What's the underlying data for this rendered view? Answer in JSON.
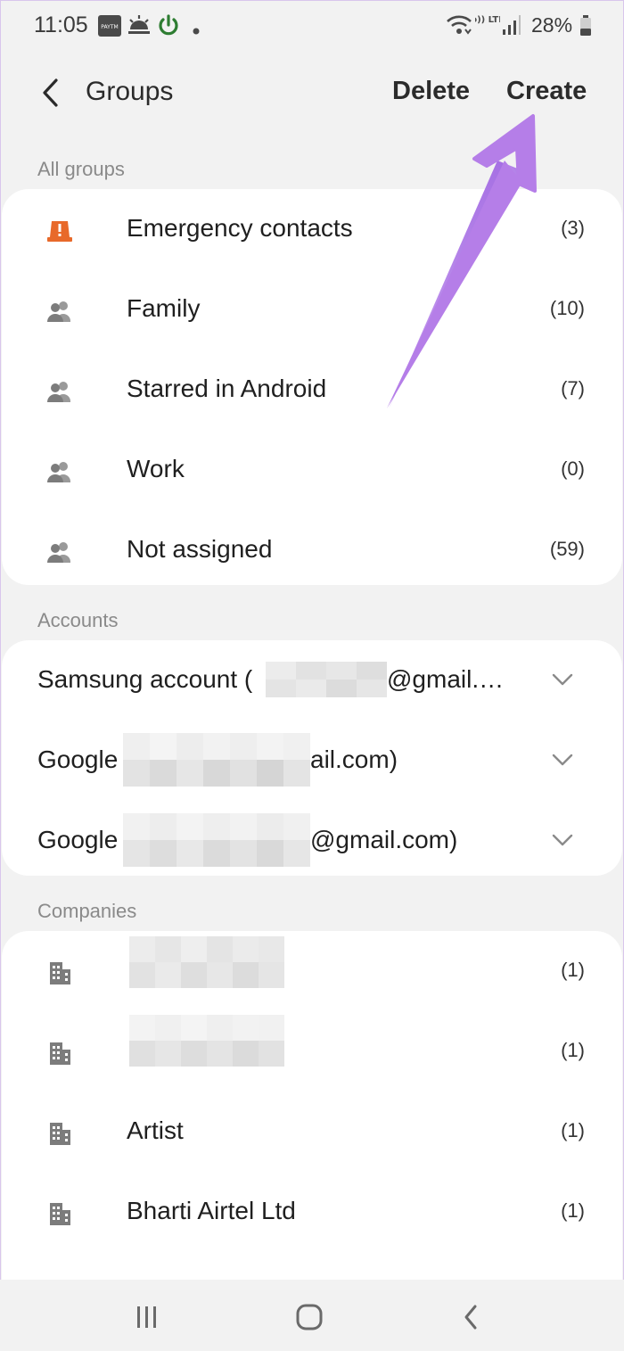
{
  "status_bar": {
    "time": "11:05",
    "paytm_label": "PAYTM",
    "volte_label": "Vo)) LTE1",
    "battery_percent": "28%",
    "icons": [
      "paytm-icon",
      "weather-icon",
      "power-icon",
      "dot-icon",
      "wifi-icon",
      "volte-icon",
      "signal-icon",
      "battery-icon"
    ]
  },
  "header": {
    "title": "Groups",
    "delete_label": "Delete",
    "create_label": "Create"
  },
  "sections": {
    "all_groups": "All groups",
    "accounts": "Accounts",
    "companies": "Companies"
  },
  "groups": [
    {
      "label": "Emergency contacts",
      "count": "(3)",
      "icon": "emergency-icon"
    },
    {
      "label": "Family",
      "count": "(10)",
      "icon": "people-icon"
    },
    {
      "label": "Starred in Android",
      "count": "(7)",
      "icon": "people-icon"
    },
    {
      "label": "Work",
      "count": "(0)",
      "icon": "people-icon"
    },
    {
      "label": "Not assigned",
      "count": "(59)",
      "icon": "people-icon"
    }
  ],
  "accounts": [
    {
      "label_start": "Samsung account (",
      "label_end": "@gmail.…"
    },
    {
      "label_start": "Google",
      "label_end": "ail.com)"
    },
    {
      "label_start": "Google",
      "label_end": "@gmail.com)"
    }
  ],
  "companies": [
    {
      "label": "",
      "count": "(1)",
      "icon": "building-icon"
    },
    {
      "label": "",
      "count": "(1)",
      "icon": "building-icon"
    },
    {
      "label": "Artist",
      "count": "(1)",
      "icon": "building-icon"
    },
    {
      "label": "Bharti Airtel Ltd",
      "count": "(1)",
      "icon": "building-icon"
    }
  ],
  "colors": {
    "background": "#f2f2f2",
    "card": "#ffffff",
    "emergency": "#e8692a",
    "icon_gray": "#8c8c8c",
    "annotation_arrow": "#b57ee8",
    "power_green": "#2e7d32"
  },
  "navigation": {
    "icons": [
      "recent-apps-icon",
      "home-icon",
      "back-icon"
    ]
  }
}
